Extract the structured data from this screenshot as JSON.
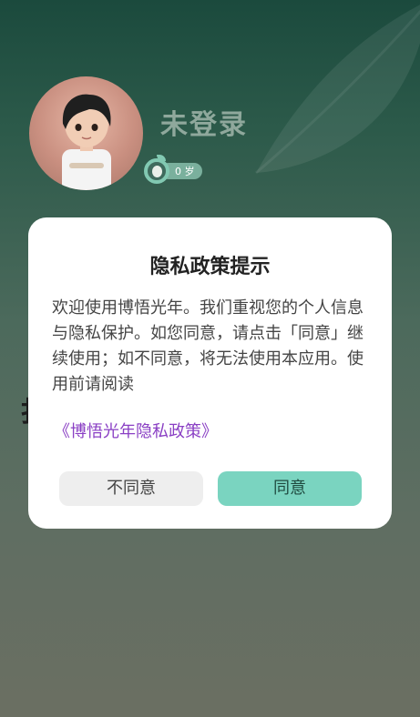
{
  "profile": {
    "username": "未登录",
    "age_label": "0 岁"
  },
  "dialog": {
    "title": "隐私政策提示",
    "body": "欢迎使用博悟光年。我们重视您的个人信息与隐私保护。如您同意，请点击「同意」继续使用；如不同意，将无法使用本应用。使用前请阅读",
    "policy_link": "《博悟光年隐私政策》",
    "disagree_label": "不同意",
    "agree_label": "同意"
  },
  "colors": {
    "accent": "#7ad4c0",
    "link": "#8a3fc4",
    "dialog_bg": "#ffffff"
  }
}
